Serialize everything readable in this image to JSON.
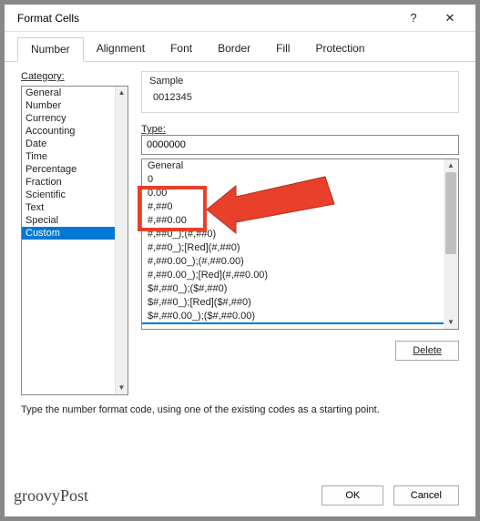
{
  "dialog": {
    "title": "Format Cells",
    "help_glyph": "?",
    "close_glyph": "✕"
  },
  "tabs": [
    {
      "label": "Number",
      "active": true
    },
    {
      "label": "Alignment",
      "active": false
    },
    {
      "label": "Font",
      "active": false
    },
    {
      "label": "Border",
      "active": false
    },
    {
      "label": "Fill",
      "active": false
    },
    {
      "label": "Protection",
      "active": false
    }
  ],
  "number_tab": {
    "category_label": "Category:",
    "categories": [
      "General",
      "Number",
      "Currency",
      "Accounting",
      "Date",
      "Time",
      "Percentage",
      "Fraction",
      "Scientific",
      "Text",
      "Special",
      "Custom"
    ],
    "category_selected": "Custom",
    "sample_label": "Sample",
    "sample_value": "0012345",
    "type_label": "Type:",
    "type_value": "0000000",
    "format_list": [
      "General",
      "0",
      "0.00",
      "#,##0",
      "#,##0.00",
      "#,##0_);(#,##0)",
      "#,##0_);[Red](#,##0)",
      "#,##0.00_);(#,##0.00)",
      "#,##0.00_);[Red](#,##0.00)",
      "$#,##0_);($#,##0)",
      "$#,##0_);[Red]($#,##0)",
      "$#,##0.00_);($#,##0.00)"
    ],
    "format_selected_index": 11,
    "delete_label": "Delete",
    "hint": "Type the number format code, using one of the existing codes as a starting point."
  },
  "footer": {
    "logo_text": "groovyPost",
    "ok_label": "OK",
    "cancel_label": "Cancel"
  },
  "colors": {
    "accent": "#0078d4",
    "highlight": "#e8402a"
  }
}
